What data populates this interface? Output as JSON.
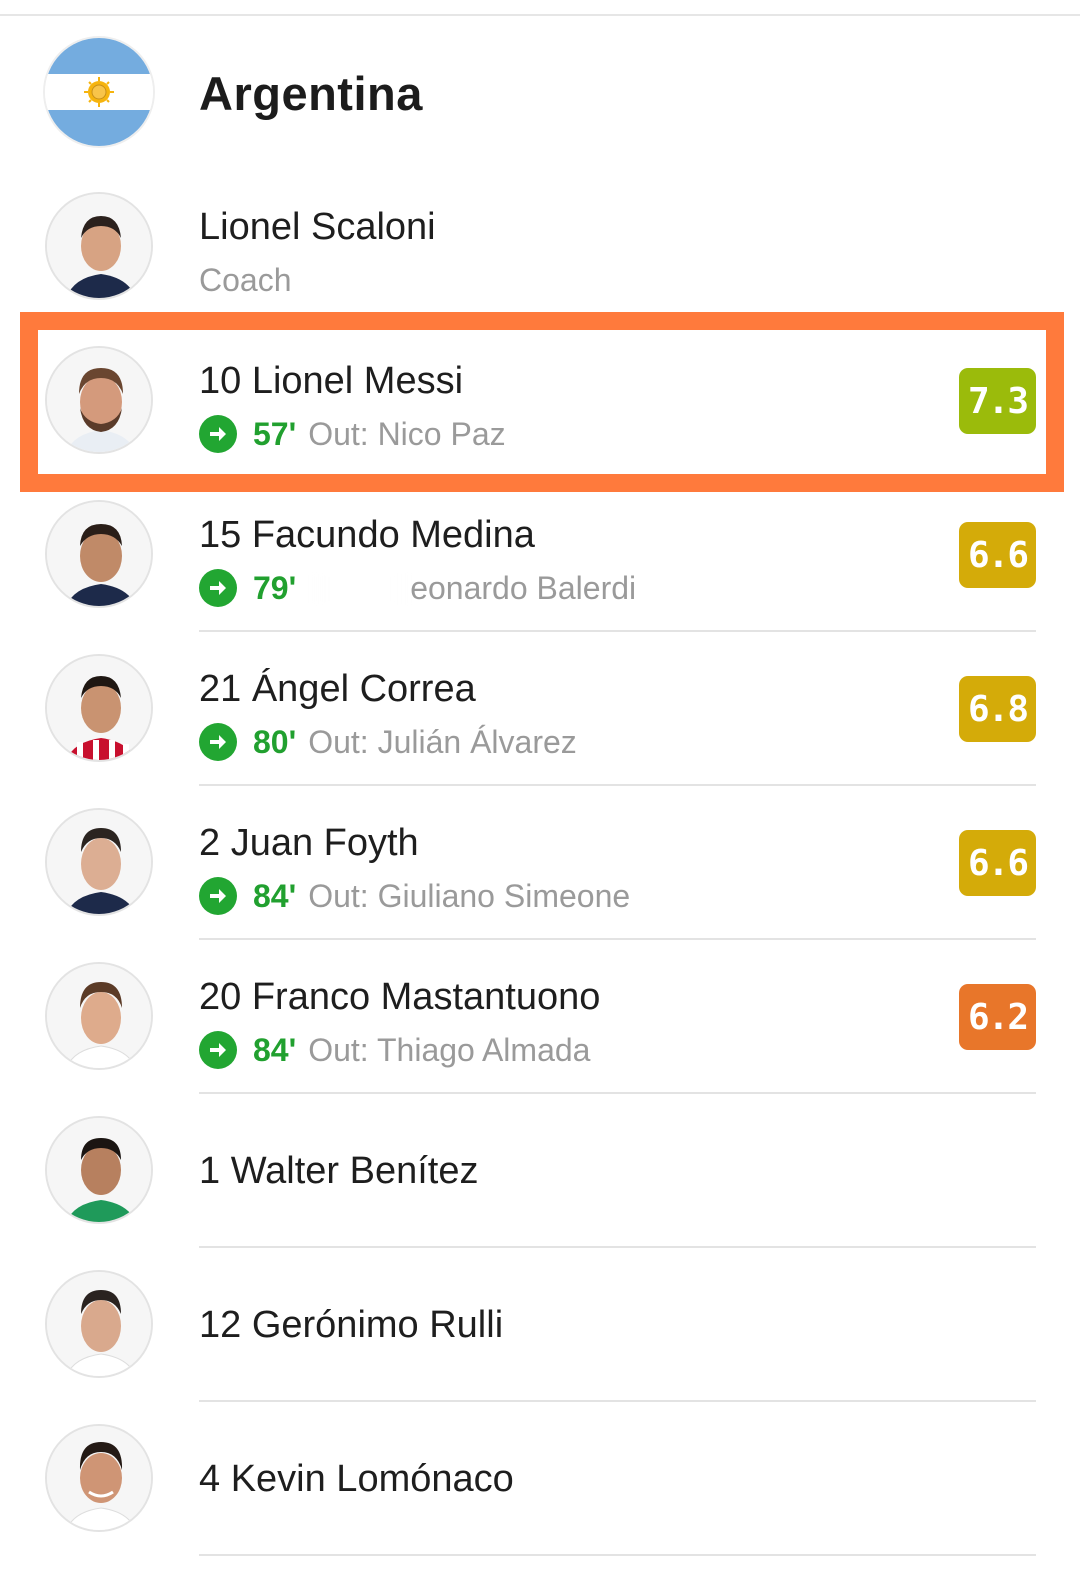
{
  "team": {
    "name": "Argentina",
    "flag_icon": "argentina-flag-icon"
  },
  "coach": {
    "name": "Lionel Scaloni",
    "role": "Coach"
  },
  "players": [
    {
      "label": "10 Lionel Messi",
      "minute": "57'",
      "out": "Out: Nico Paz",
      "rating": "7.3",
      "rating_color": "#9bbb0b",
      "highlighted": true
    },
    {
      "label": "15 Facundo Medina",
      "minute": "79'",
      "out": "eonardo Balerdi",
      "rating": "6.6",
      "rating_color": "#d4ab09"
    },
    {
      "label": "21 Ángel Correa",
      "minute": "80'",
      "out": "Out: Julián Álvarez",
      "rating": "6.8",
      "rating_color": "#d4ab09"
    },
    {
      "label": "2 Juan Foyth",
      "minute": "84'",
      "out": "Out: Giuliano Simeone",
      "rating": "6.6",
      "rating_color": "#d4ab09"
    },
    {
      "label": "20 Franco Mastantuono",
      "minute": "84'",
      "out": "Out: Thiago Almada",
      "rating": "6.2",
      "rating_color": "#e8762a"
    },
    {
      "label": "1 Walter Benítez"
    },
    {
      "label": "12 Gerónimo Rulli"
    },
    {
      "label": "4 Kevin Lomónaco"
    }
  ],
  "colors": {
    "highlight_border": "#ff7a3c",
    "sub_green": "#22a632"
  }
}
